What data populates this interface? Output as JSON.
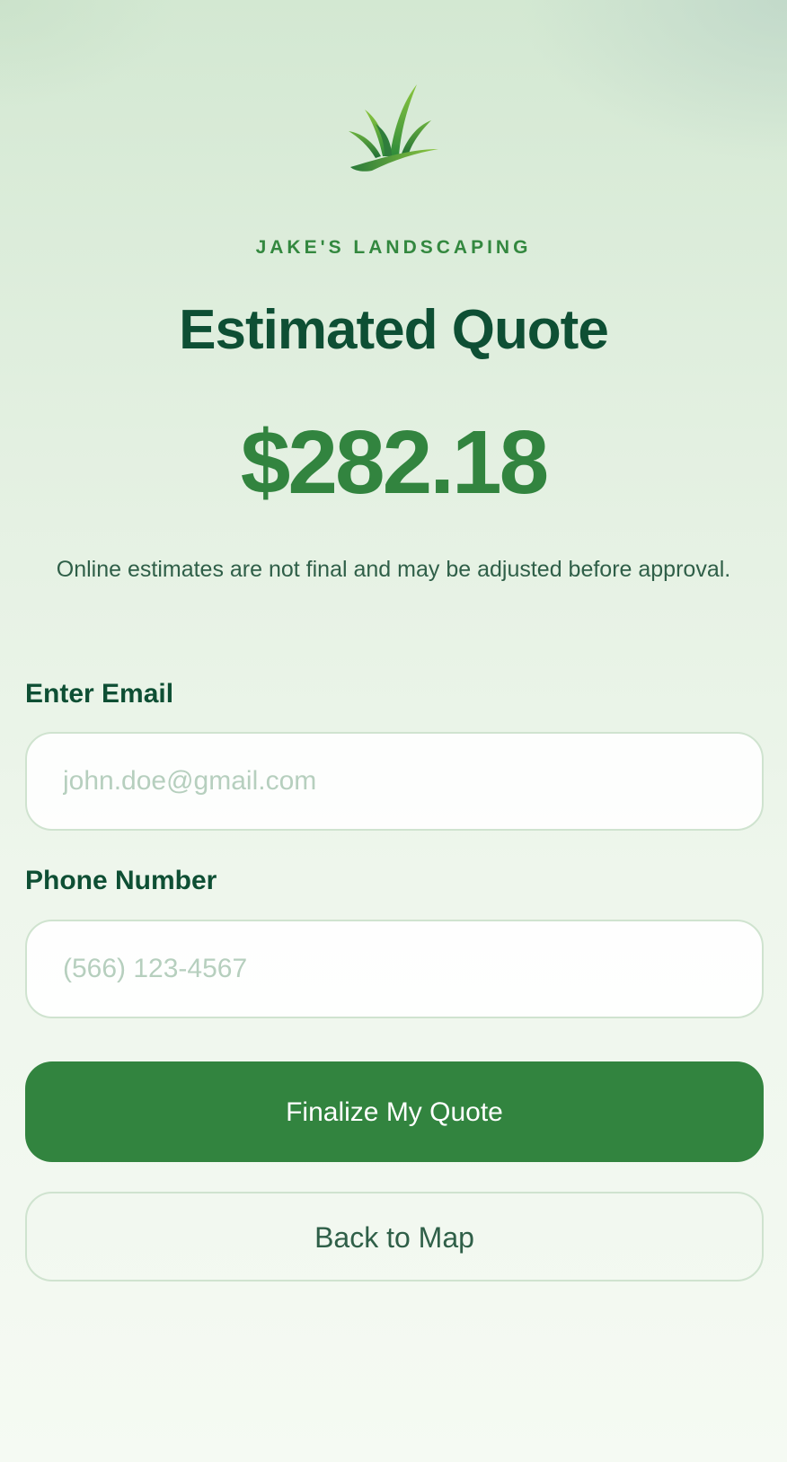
{
  "brand": {
    "logo_icon": "grass-icon",
    "name": "JAKE'S LANDSCAPING"
  },
  "quote": {
    "title": "Estimated Quote",
    "price": "$282.18",
    "disclaimer": "Online estimates are not final and may be adjusted before approval."
  },
  "form": {
    "email_label": "Enter Email",
    "email_placeholder": "john.doe@gmail.com",
    "email_value": "",
    "phone_label": "Phone Number",
    "phone_placeholder": "(566) 123-4567",
    "phone_value": ""
  },
  "actions": {
    "finalize_label": "Finalize My Quote",
    "back_label": "Back to Map"
  },
  "colors": {
    "primary": "#32843f",
    "heading": "#0e4f34",
    "brand_text": "#33883f",
    "body_text": "#2f5f48",
    "input_border": "#cfe3cf"
  }
}
